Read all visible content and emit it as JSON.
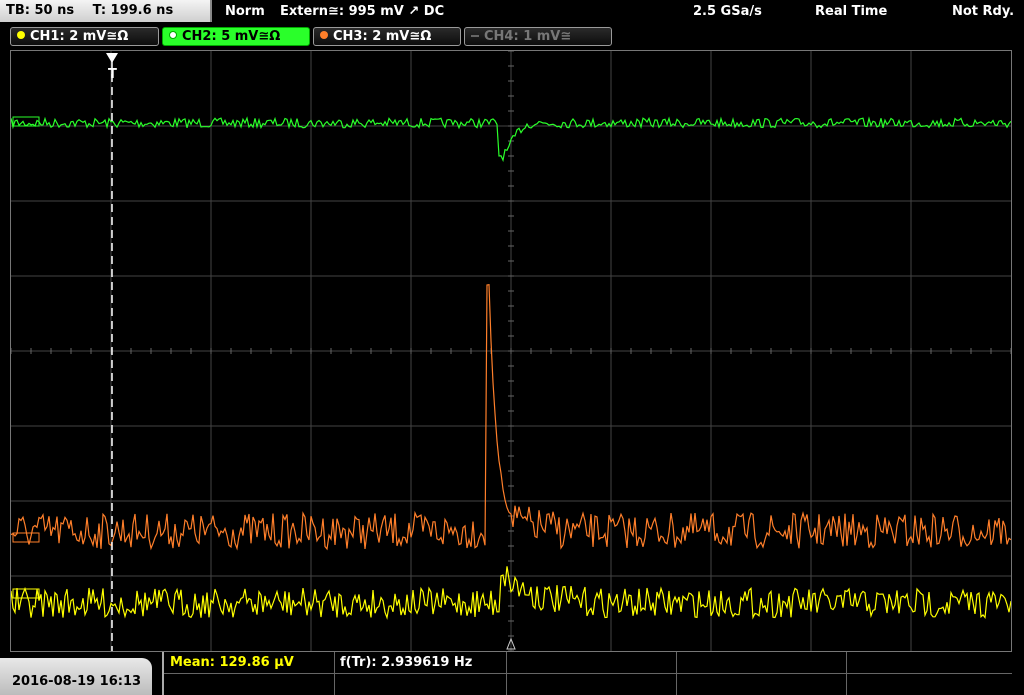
{
  "topbar": {
    "timebase": "TB: 50 ns",
    "trigger_time": "T: 199.6 ns",
    "trigger_mode": "Norm",
    "trigger_source": "Extern≅: 995 mV ↗ DC",
    "sample_rate": "2.5 GSa/s",
    "acq_mode": "Real Time",
    "status": "Not Rdy."
  },
  "channels": [
    {
      "label": "CH1: 2 mV≅Ω",
      "color": "#ffff00",
      "state": "on"
    },
    {
      "label": "CH2: 5 mV≅Ω",
      "color": "#2aff2a",
      "state": "active"
    },
    {
      "label": "CH3: 2 mV≅Ω",
      "color": "#ff7f2a",
      "state": "on"
    },
    {
      "label": "CH4: 1 mV≅",
      "color": "#777777",
      "state": "off"
    }
  ],
  "bottombar": {
    "datetime": "2016-08-19 16:13",
    "mean": "Mean: 129.86 µV",
    "freq": "f(Tr): 2.939619 Hz"
  },
  "traces": {
    "ch2": {
      "baseline": 0.12,
      "noise": 0.008,
      "dip_depth": 0.055
    },
    "ch3": {
      "baseline": 0.8,
      "noise": 0.03,
      "spike_peak": 0.39
    },
    "ch1": {
      "baseline": 0.92,
      "noise": 0.025
    }
  },
  "colors": {
    "ch1": "#ffff00",
    "ch2": "#2aff2a",
    "ch3": "#ff7f2a",
    "grid": "#444444",
    "trigger_marker": "#ffffff"
  }
}
